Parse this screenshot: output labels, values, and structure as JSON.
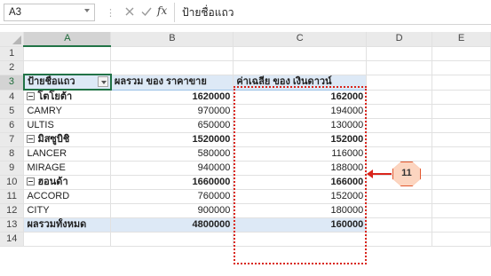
{
  "name_box": "A3",
  "formula_bar": {
    "content": "ป้ายชื่อแถว"
  },
  "columns": [
    "A",
    "B",
    "C",
    "D",
    "E"
  ],
  "rows": [
    {
      "row": "1",
      "a": "",
      "b": "",
      "c": ""
    },
    {
      "row": "2",
      "a": "",
      "b": "",
      "c": ""
    },
    {
      "row": "3",
      "a": "ป้ายชื่อแถว",
      "b": "ผลรวม ของ ราคาขาย",
      "c": "ค่าเฉลี่ย ของ เงินดาวน์"
    },
    {
      "row": "4",
      "a": "โตโยต้า",
      "b": "1620000",
      "c": "162000"
    },
    {
      "row": "5",
      "a": "CAMRY",
      "b": "970000",
      "c": "194000"
    },
    {
      "row": "6",
      "a": "ULTIS",
      "b": "650000",
      "c": "130000"
    },
    {
      "row": "7",
      "a": "มิสซูบิชิ",
      "b": "1520000",
      "c": "152000"
    },
    {
      "row": "8",
      "a": "LANCER",
      "b": "580000",
      "c": "116000"
    },
    {
      "row": "9",
      "a": "MIRAGE",
      "b": "940000",
      "c": "188000"
    },
    {
      "row": "10",
      "a": "ฮอนด้า",
      "b": "1660000",
      "c": "166000"
    },
    {
      "row": "11",
      "a": "ACCORD",
      "b": "760000",
      "c": "152000"
    },
    {
      "row": "12",
      "a": "CITY",
      "b": "900000",
      "c": "180000"
    },
    {
      "row": "13",
      "a": "ผลรวมทั้งหมด",
      "b": "4800000",
      "c": "160000"
    },
    {
      "row": "14",
      "a": "",
      "b": "",
      "c": ""
    }
  ],
  "callout": {
    "label": "11"
  },
  "colors": {
    "highlight": "#d9251c",
    "pivot_header_fill": "#dde9f6",
    "selection": "#217346",
    "callout_fill": "#fbd0b9"
  }
}
